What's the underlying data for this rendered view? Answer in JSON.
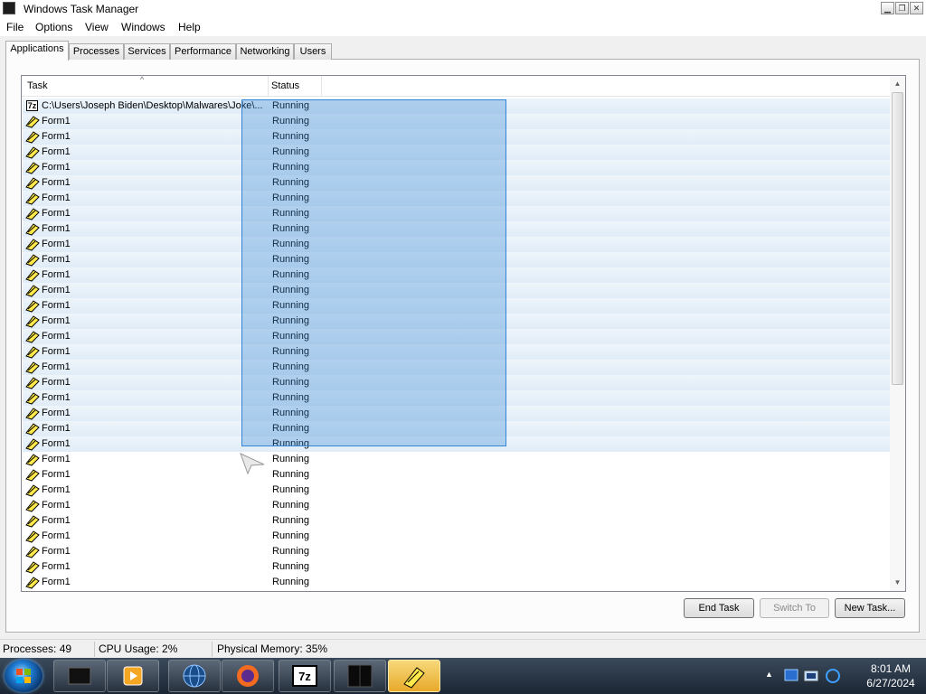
{
  "window": {
    "title": "Windows Task Manager"
  },
  "menu": [
    "File",
    "Options",
    "View",
    "Windows",
    "Help"
  ],
  "tabs": [
    "Applications",
    "Processes",
    "Services",
    "Performance",
    "Networking",
    "Users"
  ],
  "active_tab": "Applications",
  "columns": {
    "task": "Task",
    "status": "Status"
  },
  "tasks": [
    {
      "name": "C:\\Users\\Joseph Biden\\Desktop\\Malwares\\Joke\\...",
      "status": "Running",
      "icon": "7z-icon"
    },
    {
      "name": "Form1",
      "status": "Running",
      "icon": "form-icon"
    },
    {
      "name": "Form1",
      "status": "Running",
      "icon": "form-icon"
    },
    {
      "name": "Form1",
      "status": "Running",
      "icon": "form-icon"
    },
    {
      "name": "Form1",
      "status": "Running",
      "icon": "form-icon"
    },
    {
      "name": "Form1",
      "status": "Running",
      "icon": "form-icon"
    },
    {
      "name": "Form1",
      "status": "Running",
      "icon": "form-icon"
    },
    {
      "name": "Form1",
      "status": "Running",
      "icon": "form-icon"
    },
    {
      "name": "Form1",
      "status": "Running",
      "icon": "form-icon"
    },
    {
      "name": "Form1",
      "status": "Running",
      "icon": "form-icon"
    },
    {
      "name": "Form1",
      "status": "Running",
      "icon": "form-icon"
    },
    {
      "name": "Form1",
      "status": "Running",
      "icon": "form-icon"
    },
    {
      "name": "Form1",
      "status": "Running",
      "icon": "form-icon"
    },
    {
      "name": "Form1",
      "status": "Running",
      "icon": "form-icon"
    },
    {
      "name": "Form1",
      "status": "Running",
      "icon": "form-icon"
    },
    {
      "name": "Form1",
      "status": "Running",
      "icon": "form-icon"
    },
    {
      "name": "Form1",
      "status": "Running",
      "icon": "form-icon"
    },
    {
      "name": "Form1",
      "status": "Running",
      "icon": "form-icon"
    },
    {
      "name": "Form1",
      "status": "Running",
      "icon": "form-icon"
    },
    {
      "name": "Form1",
      "status": "Running",
      "icon": "form-icon"
    },
    {
      "name": "Form1",
      "status": "Running",
      "icon": "form-icon"
    },
    {
      "name": "Form1",
      "status": "Running",
      "icon": "form-icon"
    },
    {
      "name": "Form1",
      "status": "Running",
      "icon": "form-icon"
    },
    {
      "name": "Form1",
      "status": "Running",
      "icon": "form-icon"
    },
    {
      "name": "Form1",
      "status": "Running",
      "icon": "form-icon"
    },
    {
      "name": "Form1",
      "status": "Running",
      "icon": "form-icon"
    },
    {
      "name": "Form1",
      "status": "Running",
      "icon": "form-icon"
    },
    {
      "name": "Form1",
      "status": "Running",
      "icon": "form-icon"
    },
    {
      "name": "Form1",
      "status": "Running",
      "icon": "form-icon"
    },
    {
      "name": "Form1",
      "status": "Running",
      "icon": "form-icon"
    },
    {
      "name": "Form1",
      "status": "Running",
      "icon": "form-icon"
    },
    {
      "name": "Form1",
      "status": "Running",
      "icon": "form-icon"
    }
  ],
  "buttons": {
    "end_task": "End Task",
    "switch_to": "Switch To",
    "new_task": "New Task..."
  },
  "statusbar": {
    "processes": "Processes: 49",
    "cpu": "CPU Usage: 2%",
    "memory": "Physical Memory: 35%"
  },
  "taskbar": {
    "items": [
      "task-manager-icon",
      "media-player-icon",
      "globe-icon",
      "firefox-icon",
      "7z-icon",
      "terminal-icon",
      "form-icon"
    ],
    "clock_time": "8:01 AM",
    "clock_date": "6/27/2024"
  },
  "colors": {
    "selection": "#3385d6",
    "accent": "#1f7bd1"
  }
}
